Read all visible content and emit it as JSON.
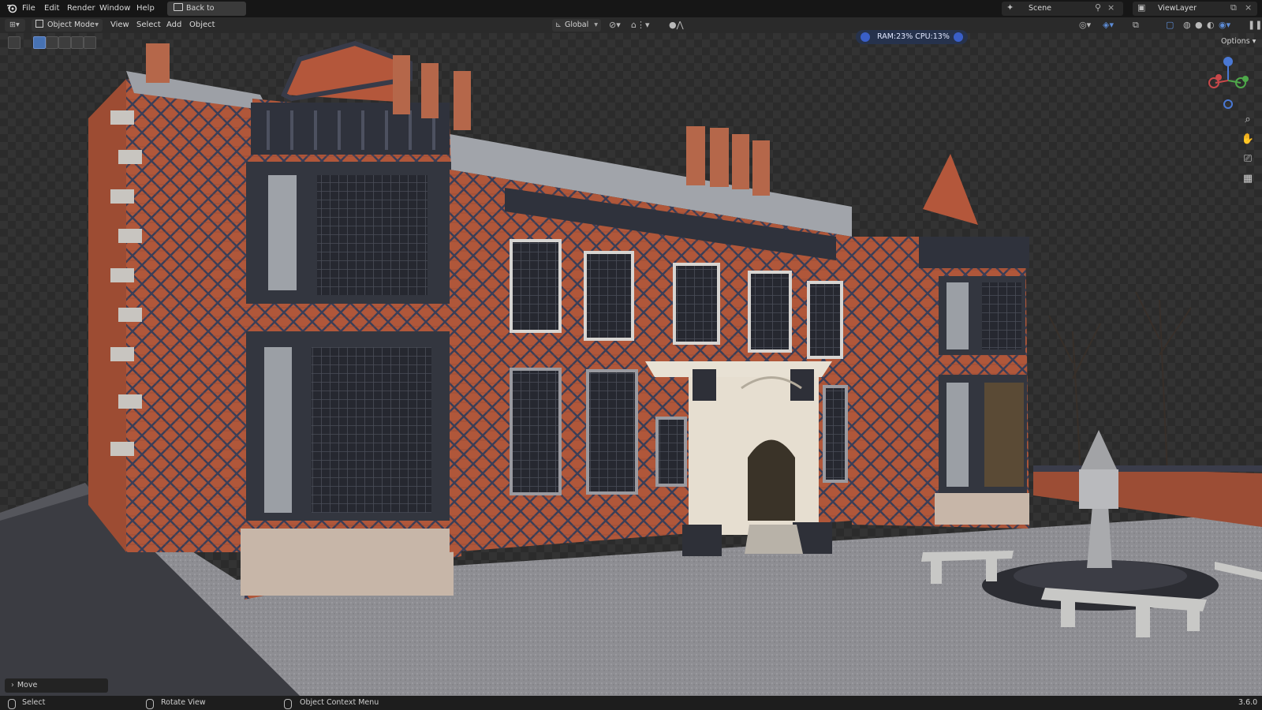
{
  "topbar": {
    "menus": [
      "File",
      "Edit",
      "Render",
      "Window",
      "Help"
    ],
    "back_button": "Back to Previous",
    "scene": "Scene",
    "view_layer": "ViewLayer"
  },
  "header": {
    "mode": "Object Mode",
    "menus": [
      "View",
      "Select",
      "Add",
      "Object"
    ],
    "orientation": "Global",
    "options": "Options"
  },
  "stats": {
    "text": "RAM:23%  CPU:13%"
  },
  "operator_panel": {
    "label": "Move"
  },
  "statusbar": {
    "items": [
      "Select",
      "Rotate View",
      "Object Context Menu"
    ],
    "version": "3.6.0"
  },
  "icons": [
    "blender-logo-icon",
    "editor-type-icon",
    "mode-icon",
    "transform-orientation-icon",
    "pivot-icon",
    "snap-icon",
    "proportional-edit-icon",
    "gizmo-icon",
    "overlay-icon",
    "xray-icon",
    "wireframe-shading-icon",
    "solid-shading-icon",
    "material-shading-icon",
    "rendered-shading-icon",
    "zoom-icon",
    "pan-hand-icon",
    "camera-icon",
    "grid-ortho-icon"
  ],
  "colors": {
    "accent": "#4772b3",
    "background": "#1d1d1d",
    "header": "#2a2a2a"
  }
}
